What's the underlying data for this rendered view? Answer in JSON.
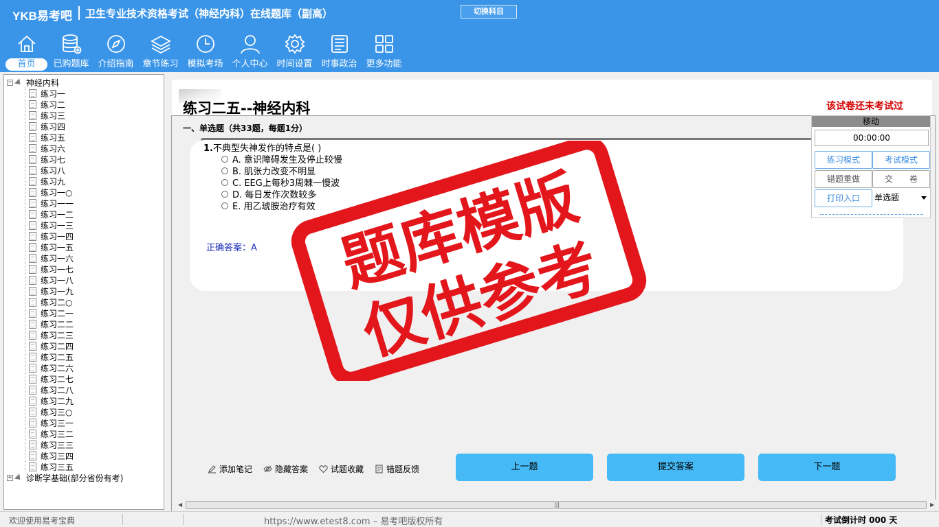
{
  "header": {
    "brand": "YKB易考吧",
    "title": "卫生专业技术资格考试（神经内科）在线题库（副高）",
    "switch_label": "切换科目"
  },
  "nav": [
    {
      "label": "首页",
      "icon": "home-icon",
      "active": true
    },
    {
      "label": "已购题库",
      "icon": "database-icon"
    },
    {
      "label": "介绍指南",
      "icon": "compass-icon"
    },
    {
      "label": "章节练习",
      "icon": "layers-icon"
    },
    {
      "label": "模拟考场",
      "icon": "clock-icon"
    },
    {
      "label": "个人中心",
      "icon": "user-icon"
    },
    {
      "label": "时间设置",
      "icon": "gear-icon"
    },
    {
      "label": "时事政治",
      "icon": "news-icon"
    },
    {
      "label": "更多功能",
      "icon": "grid-icon"
    }
  ],
  "tree": {
    "root": "神经内科",
    "items": [
      "练习一",
      "练习二",
      "练习三",
      "练习四",
      "练习五",
      "练习六",
      "练习七",
      "练习八",
      "练习九",
      "练习一○",
      "练习一一",
      "练习一二",
      "练习一三",
      "练习一四",
      "练习一五",
      "练习一六",
      "练习一七",
      "练习一八",
      "练习一九",
      "练习二○",
      "练习二一",
      "练习二二",
      "练习二三",
      "练习二四",
      "练习二五",
      "练习二六",
      "练习二七",
      "练习二八",
      "练习二九",
      "练习三○",
      "练习三一",
      "练习三二",
      "练习三三",
      "练习三四",
      "练习三五"
    ],
    "root2": "诊断学基础(部分省份有考)"
  },
  "paper": {
    "title": "练习二五--神经内科",
    "status": "该试卷还未考试过",
    "section": "一、单选题（共33题，每题1分）"
  },
  "question": {
    "number": "1.",
    "stem": "不典型失神发作的特点是( )",
    "options": [
      "A. 意识障碍发生及停止较慢",
      "B. 肌张力改变不明显",
      "C. EEG上每秒3周棘一慢波",
      "D. 每日发作次数较多",
      "E. 用乙琥胺治疗有效"
    ],
    "answer": "正确答案：A"
  },
  "tools": [
    "添加笔记",
    "隐藏答案",
    "试题收藏",
    "错题反馈"
  ],
  "buttons": {
    "prev": "上一题",
    "submit": "提交答案",
    "next": "下一题"
  },
  "side": {
    "move": "移动",
    "timer": "00:00:00",
    "practice_mode": "练习模式",
    "exam_mode": "考试模式",
    "redo_wrong": "错题重做",
    "hand_in": "交　　卷",
    "print": "打印入口",
    "type_select": "单选题"
  },
  "status": {
    "welcome": "欢迎使用易考宝典",
    "copyright": "https://www.etest8.com – 易考吧版权所有",
    "countdown": "考试倒计时 000 天"
  },
  "stamp": {
    "line1": "题库模版",
    "line2": "仅供参考"
  },
  "colors": {
    "topbar": "#3a95e8",
    "button": "#46baf6",
    "stamp": "#e3161b",
    "status_red": "#d40000",
    "answer": "#1a2cb8"
  }
}
